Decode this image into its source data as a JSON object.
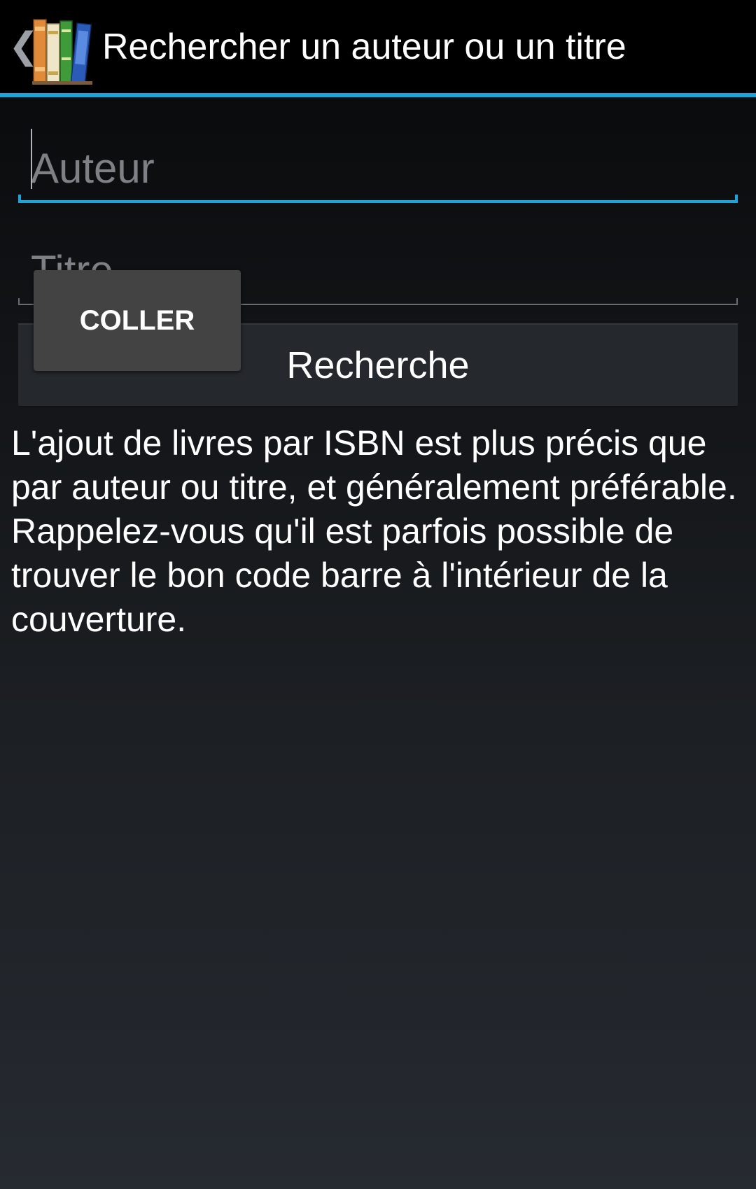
{
  "actionbar": {
    "up_icon": "chevron-left-icon",
    "app_icon": "books-app-icon",
    "title": "Rechercher un auteur ou un titre"
  },
  "form": {
    "author_placeholder": "Auteur",
    "author_value": "",
    "title_placeholder": "Titre",
    "title_value": "",
    "search_label": "Recherche"
  },
  "context_menu": {
    "paste_label": "COLLER"
  },
  "info": {
    "text": "L'ajout de livres par ISBN est plus précis que par auteur ou titre, et généralement préférable. Rappelez-vous qu'il est parfois possible de trouver le bon code barre à l'intérieur de la couverture."
  },
  "colors": {
    "accent": "#1ea3d8",
    "actionbar_bg": "#000000",
    "popup_bg": "#434343",
    "button_bg": "#25282c"
  }
}
